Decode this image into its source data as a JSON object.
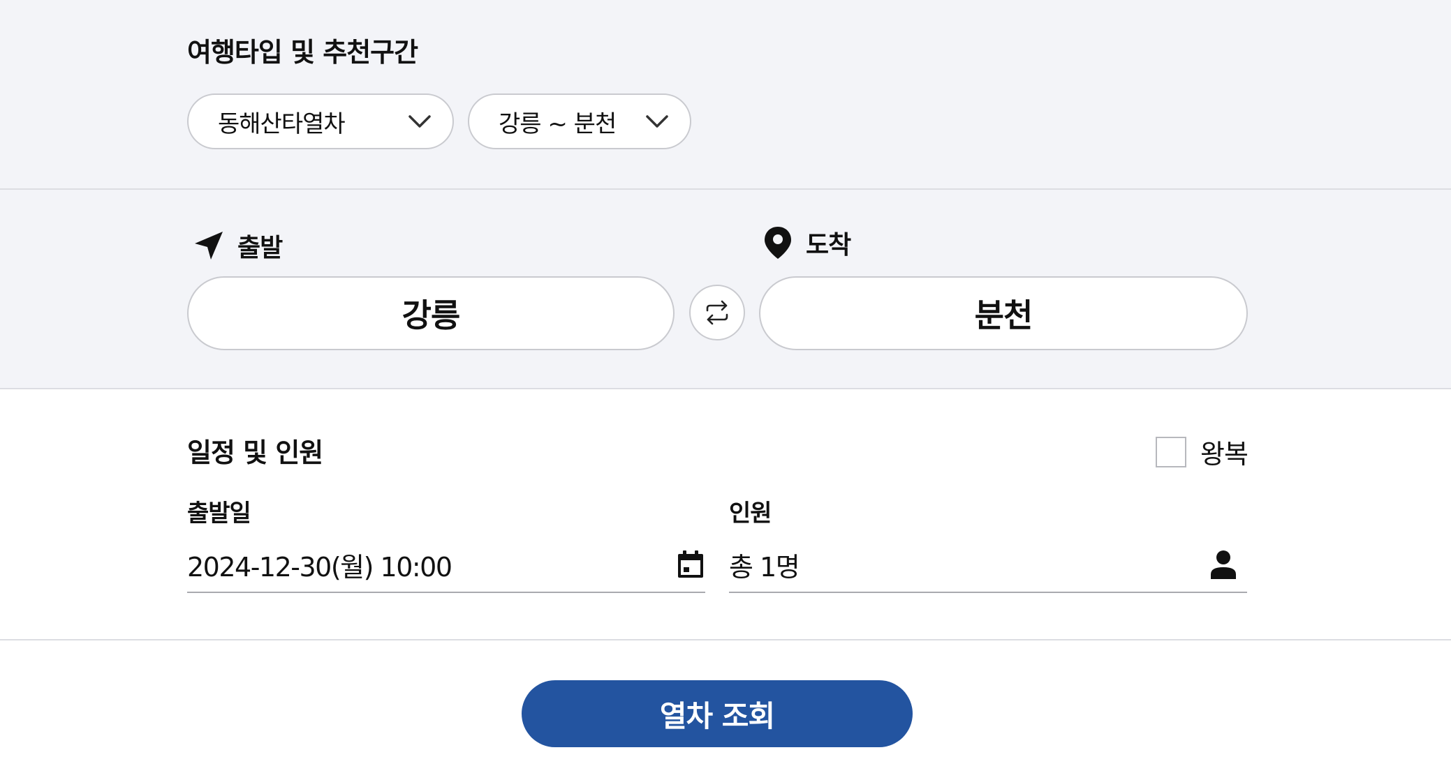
{
  "travel_type": {
    "heading": "여행타입 및 추천구간",
    "type_select": "동해산타열차",
    "section_select": "강릉 ~ 분천"
  },
  "route": {
    "departure_label": "출발",
    "arrival_label": "도착",
    "departure_station": "강릉",
    "arrival_station": "분천"
  },
  "schedule": {
    "heading": "일정 및 인원",
    "roundtrip_label": "왕복",
    "roundtrip_checked": false,
    "date_label": "출발일",
    "date_value": "2024-12-30(월) 10:00",
    "people_label": "인원",
    "people_value": "총 1명"
  },
  "actions": {
    "search_label": "열차 조회"
  },
  "colors": {
    "accent": "#2354a0",
    "panel_bg": "#f3f4f8",
    "border": "#c9cacf"
  },
  "icons": {
    "type_chevron": "chevron-down-icon",
    "section_chevron": "chevron-down-icon",
    "departure": "navigation-arrow-icon",
    "arrival": "map-pin-icon",
    "swap": "swap-arrows-icon",
    "calendar": "calendar-icon",
    "person": "person-icon"
  }
}
